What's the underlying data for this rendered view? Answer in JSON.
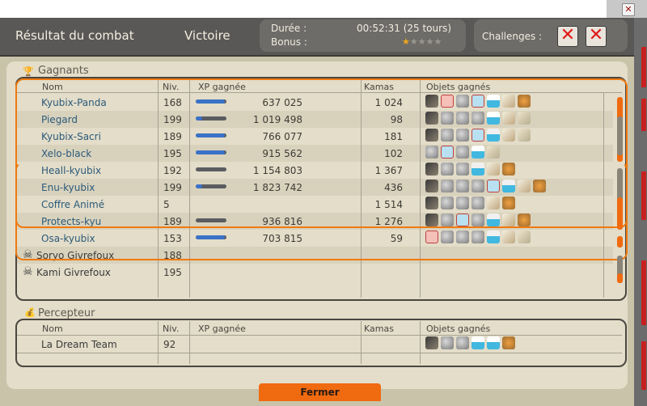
{
  "header": {
    "title": "Résultat du combat",
    "result": "Victoire",
    "duration_label": "Durée :",
    "duration_value": "00:52:31 (25 tours)",
    "bonus_label": "Bonus :",
    "bonus_stars": 1,
    "bonus_stars_total": 5,
    "challenges_label": "Challenges :",
    "challenge_icons": [
      "challenge-failed-icon",
      "challenge-failed-icon"
    ]
  },
  "winners": {
    "section_title": "Gagnants",
    "columns": [
      "Nom",
      "Niv.",
      "XP gagnée",
      "Kamas",
      "Objets gagnés"
    ],
    "rows": [
      {
        "name": "Kyubix-Panda",
        "level": "168",
        "xp": "637 025",
        "xp_fill": 0.95,
        "kamas": "1 024",
        "items": [
          "scroll-icon",
          "pink-resource-icon",
          "gray-resource-icon",
          "blue-scroll-icon",
          "potion-x2-icon",
          "feather-icon",
          "bread-icon"
        ]
      },
      {
        "name": "Piegard",
        "level": "199",
        "xp": "1 019 498",
        "xp_fill": 0.2,
        "kamas": "98",
        "items": [
          "scroll-icon",
          "gray-resource-icon",
          "gray-resource-icon",
          "gray-resource-icon",
          "potion-x2-icon",
          "feather-icon",
          "bone-icon"
        ]
      },
      {
        "name": "Kyubix-Sacri",
        "level": "189",
        "xp": "766 077",
        "xp_fill": 0.95,
        "kamas": "181",
        "items": [
          "scroll-icon",
          "gray-resource-icon",
          "gray-resource-icon",
          "blue-scroll-icon",
          "potion-icon",
          "feather-icon",
          "bone-icon"
        ]
      },
      {
        "name": "Xelo-black",
        "level": "195",
        "xp": "915 562",
        "xp_fill": 0.95,
        "kamas": "102",
        "items": [
          "gray-resource-icon",
          "blue-scroll-icon",
          "gray-resource-icon",
          "potion-x2-icon",
          "bone-icon"
        ]
      },
      {
        "name": "Heall-kyubix",
        "level": "192",
        "xp": "1 154 803",
        "xp_fill": 0.0,
        "kamas": "1 367",
        "items": [
          "scroll-icon",
          "gray-resource-icon",
          "gray-resource-icon",
          "potion-icon",
          "feather-icon",
          "bread-icon"
        ]
      },
      {
        "name": "Enu-kyubix",
        "level": "199",
        "xp": "1 823 742",
        "xp_fill": 0.2,
        "kamas": "436",
        "items": [
          "scroll-icon",
          "gray-resource-icon",
          "gray-resource-icon",
          "gray-resource-icon",
          "blue-scroll-icon",
          "potion-icon",
          "feather-icon",
          "bread-icon"
        ]
      },
      {
        "name": "Coffre Animé",
        "level": "5",
        "xp": "",
        "xp_fill": null,
        "kamas": "1 514",
        "items": [
          "scroll-icon",
          "gray-resource-icon",
          "gray-resource-icon",
          "gray-resource-icon",
          "feather-icon",
          "bread-icon"
        ]
      },
      {
        "name": "Protects-kyu",
        "level": "189",
        "xp": "936 816",
        "xp_fill": 0.0,
        "kamas": "1 276",
        "items": [
          "scroll-icon",
          "gray-resource-icon",
          "blue-scroll-icon",
          "gray-resource-icon",
          "potion-icon",
          "feather-icon",
          "bread-icon"
        ]
      },
      {
        "name": "Osa-kyubix",
        "level": "153",
        "xp": "703 815",
        "xp_fill": 0.95,
        "kamas": "59",
        "items": [
          "pink-resource-icon",
          "gray-resource-icon",
          "gray-resource-icon",
          "gray-resource-icon",
          "potion-icon",
          "feather-icon",
          "bone-icon"
        ]
      },
      {
        "name": "Soryo Givrefoux",
        "level": "188",
        "xp": "",
        "xp_fill": null,
        "kamas": "",
        "items": [],
        "dead": true
      },
      {
        "name": "Kami Givrefoux",
        "level": "195",
        "xp": "",
        "xp_fill": null,
        "kamas": "",
        "items": [],
        "dead": true
      }
    ]
  },
  "percepteur": {
    "section_title": "Percepteur",
    "columns": [
      "Nom",
      "Niv.",
      "XP gagnée",
      "Kamas",
      "Objets gagnés"
    ],
    "rows": [
      {
        "name": "La Dream Team",
        "level": "92",
        "xp": "",
        "kamas": "",
        "items": [
          "scroll-icon",
          "gray-resource-icon",
          "gray-resource-icon",
          "potion-x2-icon",
          "potion-x2-icon",
          "bread-icon"
        ]
      }
    ]
  },
  "footer": {
    "close_label": "Fermer"
  },
  "colors": {
    "accent": "#f07a10",
    "name_link": "#2c5a7a",
    "xp_bar": "#3a72c8"
  }
}
